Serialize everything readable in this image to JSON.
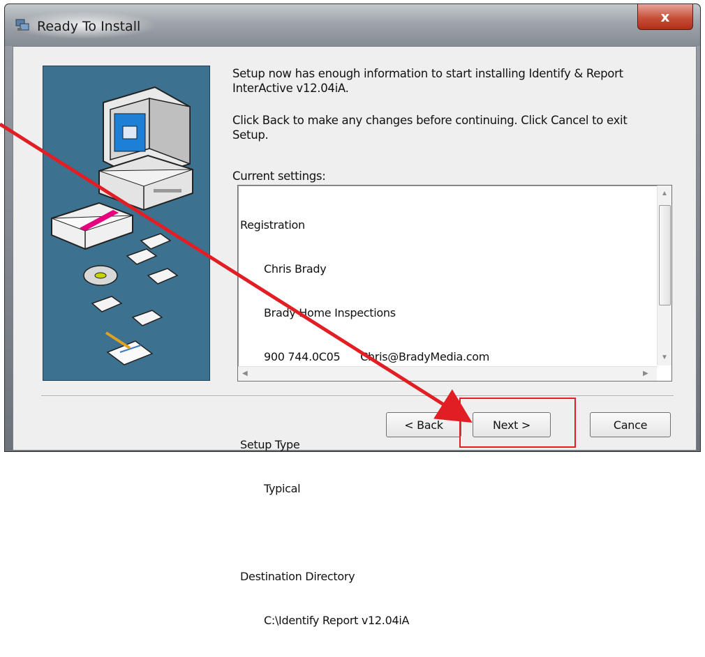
{
  "window": {
    "title": "Ready To Install",
    "close_label": "x"
  },
  "info": {
    "paragraph1_line1": "Setup now has enough information to start installing Identify & Report",
    "paragraph1_line2": "InterActive v12.04iA.",
    "paragraph2_line1": "Click Back to make any changes before continuing. Click Cancel to exit",
    "paragraph2_line2": "Setup."
  },
  "settings": {
    "label": "Current settings:",
    "lines": [
      {
        "text": "Registration",
        "indent": false
      },
      {
        "text": "Chris Brady",
        "indent": true
      },
      {
        "text": "Brady Home Inspections",
        "indent": true
      },
      {
        "text": "900 744.0C05      Chris@BradyMedia.com",
        "indent": true
      },
      {
        "text": "",
        "indent": false
      },
      {
        "text": "Setup Type",
        "indent": false
      },
      {
        "text": "Typical",
        "indent": true
      },
      {
        "text": "",
        "indent": false
      },
      {
        "text": "Destination Directory",
        "indent": false
      },
      {
        "text": "C:\\Identify Report v12.04iA",
        "indent": true
      }
    ]
  },
  "buttons": {
    "back": "< Back",
    "next": "Next >",
    "cancel": "Cance"
  },
  "colors": {
    "banner": "#3c7290",
    "highlight": "#e21e25"
  }
}
